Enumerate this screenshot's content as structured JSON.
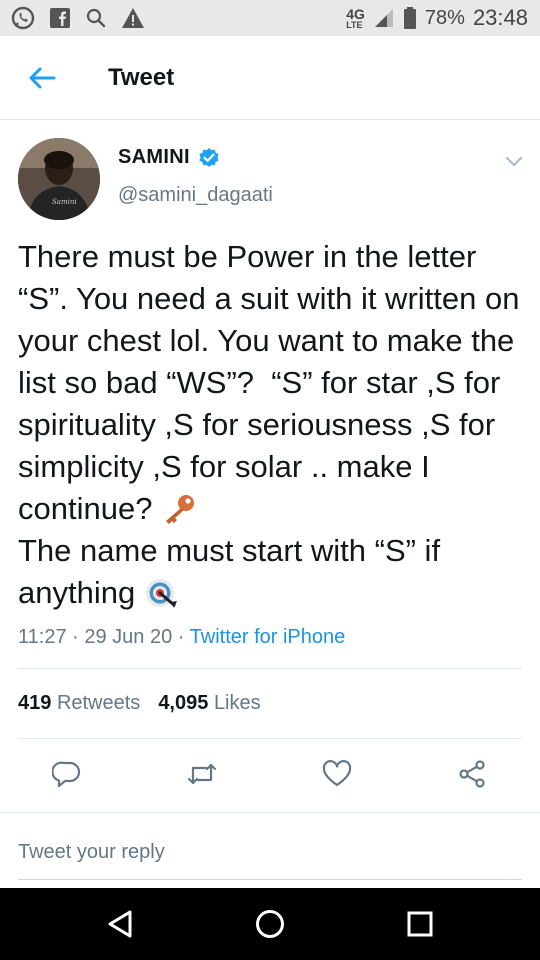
{
  "status_bar": {
    "network": "4G",
    "network_sub": "LTE",
    "battery": "78%",
    "time": "23:48"
  },
  "app_bar": {
    "title": "Tweet"
  },
  "tweet": {
    "author_name": "SAMINI",
    "author_handle": "@samini_dagaati",
    "verified": true,
    "avatar_shirt_text": "Samini",
    "text_main": "There must be Power in the letter “S”. You need a suit with it written on your chest lol. You want to make the list so bad “WS”?  “S” for star ,S for spirituality ,S for seriousness ,S for simplicity ,S for solar .. make I continue? ",
    "text_end_1": "The name must start with “S” if anything ",
    "emoji_1": "key",
    "emoji_2": "direct-hit",
    "time": "11:27",
    "date": "29 Jun 20",
    "source": "Twitter for iPhone",
    "retweets_count": "419",
    "retweets_label": "Retweets",
    "likes_count": "4,095",
    "likes_label": "Likes"
  },
  "reply": {
    "placeholder": "Tweet your reply"
  },
  "colors": {
    "link_blue": "#1b95e0",
    "verified_blue": "#1da1f2",
    "muted_gray": "#657786"
  }
}
